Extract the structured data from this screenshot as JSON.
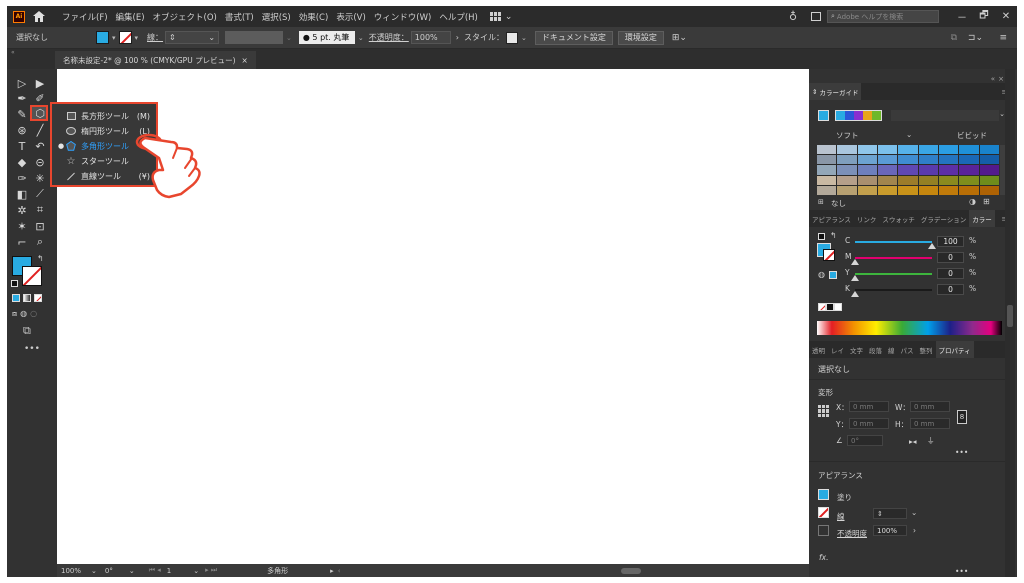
{
  "menubar": {
    "logo": "Ai",
    "items": [
      "ファイル(F)",
      "編集(E)",
      "オブジェクト(O)",
      "書式(T)",
      "選択(S)",
      "効果(C)",
      "表示(V)",
      "ウィンドウ(W)",
      "ヘルプ(H)"
    ],
    "help_placeholder": "Adobe ヘルプを検索",
    "window_buttons": [
      "－",
      "🗗",
      "✕"
    ]
  },
  "controlbar": {
    "selection": "選択なし",
    "stroke_label": "線：",
    "brush": "● 5 pt. 丸筆",
    "opacity_label": "不透明度：",
    "opacity_value": "100%",
    "style_label": "スタイル：",
    "doc_setup": "ドキュメント設定",
    "preferences": "環境設定"
  },
  "tab": {
    "title": "名称未設定-2* @ 100 % (CMYK/GPU プレビュー)",
    "close": "×"
  },
  "flyout": {
    "items": [
      {
        "label": "長方形ツール",
        "shortcut": "(M)"
      },
      {
        "label": "楕円形ツール",
        "shortcut": "(L)"
      },
      {
        "label": "多角形ツール",
        "shortcut": ""
      },
      {
        "label": "スターツール",
        "shortcut": ""
      },
      {
        "label": "直線ツール",
        "shortcut": "(¥)"
      }
    ],
    "selected_index": 2
  },
  "colorguide": {
    "tab": "カラーガイド",
    "soft": "ソフト",
    "vivid": "ビビッド",
    "none_label": "なし",
    "grid_colors": [
      [
        "#b9c3cf",
        "#a9c6de",
        "#8fc6ea",
        "#7bc0ec",
        "#56b2ea",
        "#3aa6e6",
        "#2b9ee4",
        "#1f90d8",
        "#1983cc"
      ],
      [
        "#8a97a7",
        "#7f9fbd",
        "#6ca3d1",
        "#5a9bd6",
        "#3f8dd1",
        "#2f7fc8",
        "#2474c0",
        "#1a68b6",
        "#145ea8"
      ],
      [
        "#93a7b8",
        "#7c90b8",
        "#6e7fbd",
        "#6a66bb",
        "#6048b3",
        "#5a3aac",
        "#5d2fa6",
        "#5a2399",
        "#531a8c"
      ],
      [
        "#c9b9a3",
        "#b59f8a",
        "#a98f6f",
        "#a2854d",
        "#9c7c2a",
        "#948023",
        "#8b8a1e",
        "#7f8e1c",
        "#6e8c1b"
      ],
      [
        "#b3a99a",
        "#b7a071",
        "#c29f4c",
        "#c99b2c",
        "#c89219",
        "#c5860e",
        "#c07a0a",
        "#b86e06",
        "#ae6204"
      ]
    ]
  },
  "color_panel": {
    "tabs": [
      "アピアランス",
      "リンク",
      "スウォッチ",
      "グラデーション",
      "カラー"
    ],
    "channels": [
      {
        "label": "C",
        "value": "100",
        "unit": "%",
        "track": "#29abe2",
        "level": 1.0
      },
      {
        "label": "M",
        "value": "0",
        "unit": "%",
        "track": "#e0006e",
        "level": 0.0
      },
      {
        "label": "Y",
        "value": "0",
        "unit": "%",
        "track": "#3db53d",
        "level": 0.0
      },
      {
        "label": "K",
        "value": "0",
        "unit": "%",
        "track": "#1a1a1a",
        "level": 0.0
      }
    ]
  },
  "properties": {
    "tabs": [
      "透明",
      "レイ",
      "文字",
      "段落",
      "線",
      "パス",
      "整列",
      "プロパティ"
    ],
    "selection": "選択なし",
    "transform_title": "変形",
    "x_label": "X：",
    "y_label": "Y：",
    "w_label": "W：",
    "h_label": "H：",
    "field_unit": "0 mm",
    "angle_value": "0°",
    "appearance_title": "アピアランス",
    "fill_label": "塗り",
    "stroke_label": "線",
    "opacity_label": "不透明度",
    "opacity_value": "100%",
    "fx_label": "fx."
  },
  "status": {
    "zoom": "100%",
    "angle": "0°",
    "artboard": "1",
    "tool": "多角形"
  }
}
